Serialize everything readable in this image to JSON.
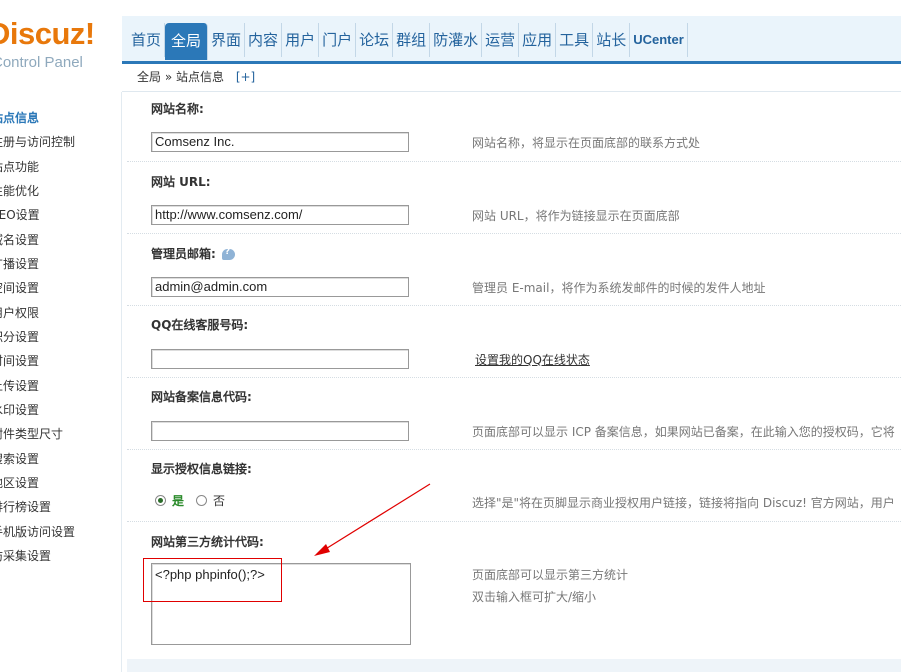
{
  "logo": {
    "brand": "Discuz!",
    "subtitle": "Control Panel"
  },
  "nav": {
    "items": [
      "首页",
      "全局",
      "界面",
      "内容",
      "用户",
      "门户",
      "论坛",
      "群组",
      "防灌水",
      "运营",
      "应用",
      "工具",
      "站长",
      "UCenter"
    ],
    "active_index": 1
  },
  "breadcrumb": {
    "path": "全局 » 站点信息",
    "add": "[+]"
  },
  "sidebar": {
    "items": [
      "站点信息",
      "注册与访问控制",
      "站点功能",
      "性能优化",
      "SEO设置",
      "域名设置",
      "广播设置",
      "空间设置",
      "用户权限",
      "积分设置",
      "时间设置",
      "上传设置",
      "水印设置",
      "附件类型尺寸",
      "搜索设置",
      "地区设置",
      "排行榜设置",
      "手机版访问设置",
      "防采集设置"
    ],
    "active_index": 0
  },
  "settings": {
    "site_name": {
      "label": "网站名称:",
      "value": "Comsenz Inc.",
      "desc": "网站名称，将显示在页面底部的联系方式处"
    },
    "site_url": {
      "label": "网站 URL:",
      "value": "http://www.comsenz.com/",
      "desc": "网站 URL，将作为链接显示在页面底部"
    },
    "admin_email": {
      "label": "管理员邮箱:",
      "value": "admin@admin.com",
      "desc": "管理员 E-mail，将作为系统发邮件的时候的发件人地址"
    },
    "qq": {
      "label": "QQ在线客服号码:",
      "value": "",
      "link": "设置我的QQ在线状态"
    },
    "icp": {
      "label": "网站备案信息代码:",
      "value": "",
      "desc": "页面底部可以显示 ICP 备案信息，如果网站已备案，在此输入您的授权码，它将"
    },
    "license_link": {
      "label": "显示授权信息链接:",
      "yes": "是",
      "no": "否",
      "selected": "yes",
      "desc": "选择\"是\"将在页脚显示商业授权用户链接，链接将指向 Discuz! 官方网站，用户"
    },
    "stats_code": {
      "label": "网站第三方统计代码:",
      "value": "<?php phpinfo();?>",
      "desc1": "页面底部可以显示第三方统计",
      "desc2": "双击输入框可扩大/缩小"
    }
  },
  "colors": {
    "brand_orange": "#e8780b",
    "nav_blue": "#2b78b8",
    "annotation_red": "#e00000"
  }
}
